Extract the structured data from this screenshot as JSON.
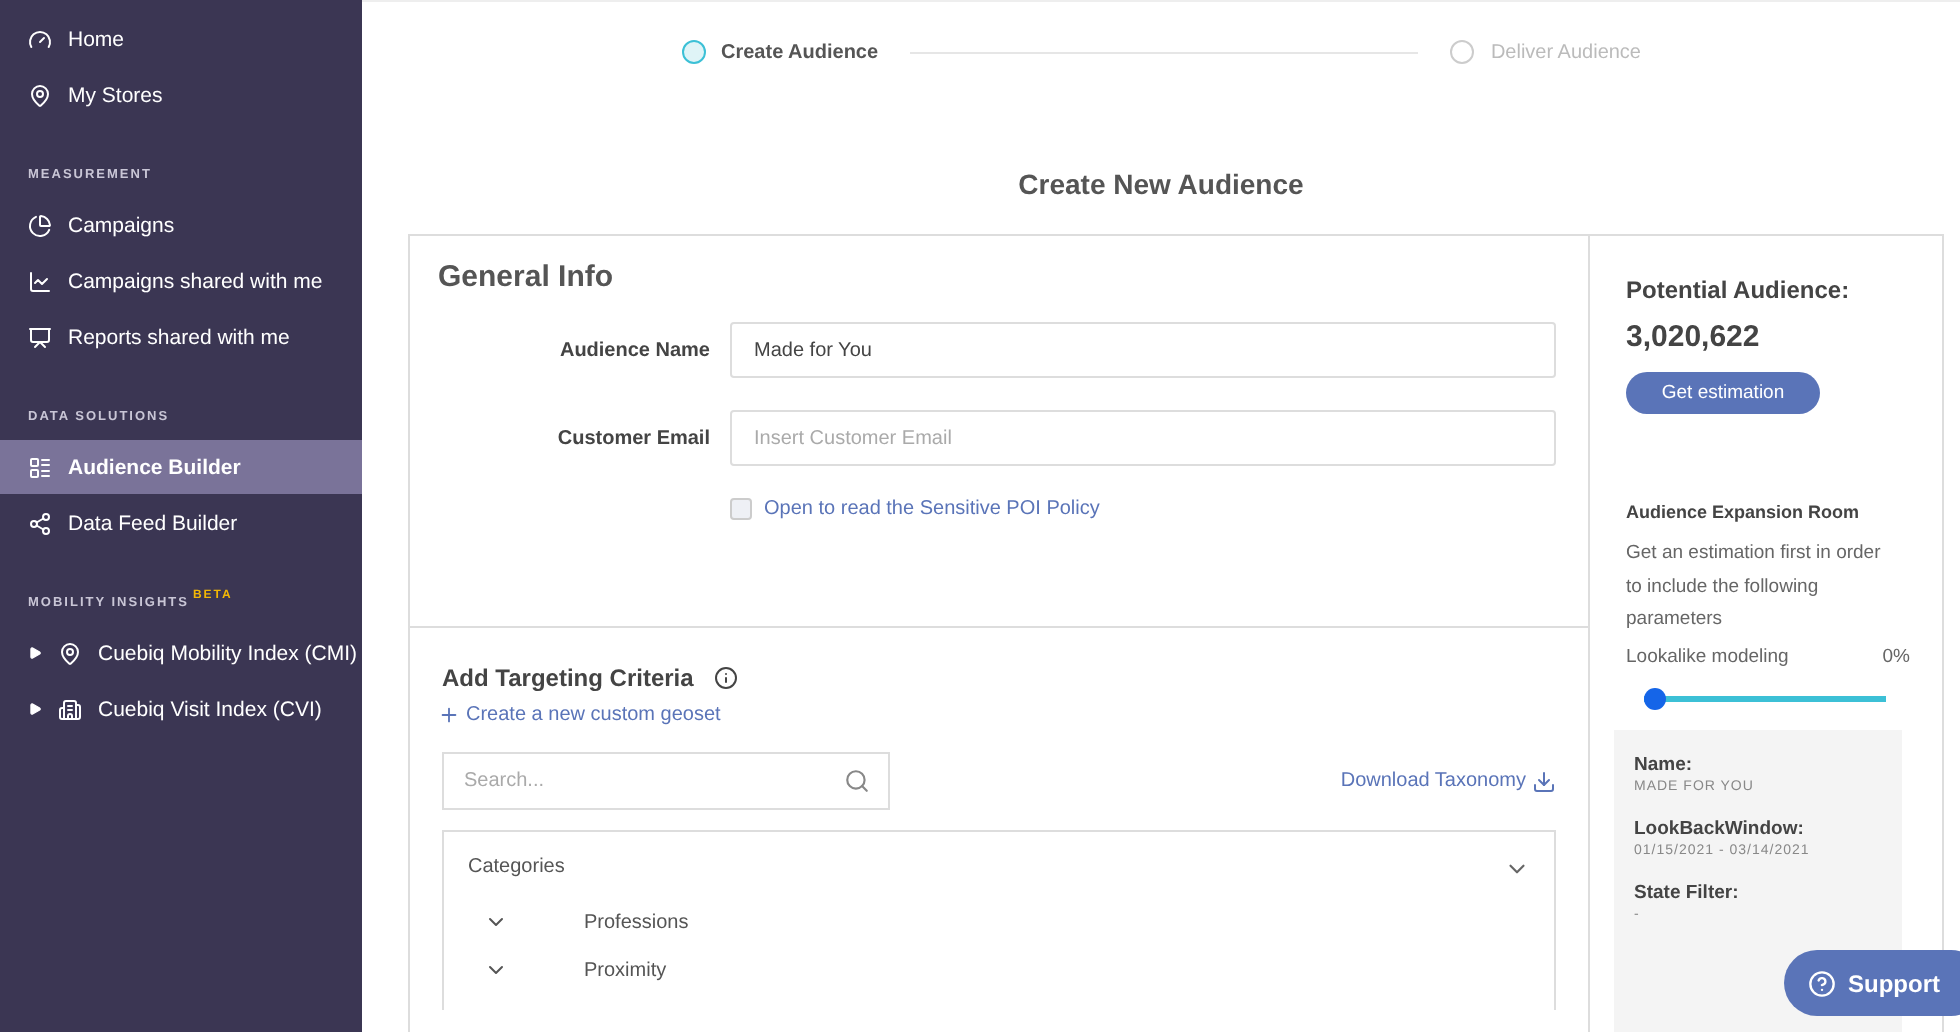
{
  "sidebar": {
    "items": [
      {
        "kind": "item",
        "label": "Home",
        "selected": false
      },
      {
        "kind": "item",
        "label": "My Stores",
        "selected": false
      },
      {
        "kind": "section",
        "label": "MEASUREMENT"
      },
      {
        "kind": "item",
        "label": "Campaigns",
        "selected": false
      },
      {
        "kind": "item",
        "label": "Campaigns shared with me",
        "selected": false
      },
      {
        "kind": "item",
        "label": "Reports shared with me",
        "selected": false
      },
      {
        "kind": "section",
        "label": "DATA SOLUTIONS"
      },
      {
        "kind": "item",
        "label": "Audience Builder",
        "selected": true
      },
      {
        "kind": "item",
        "label": "Data Feed Builder",
        "selected": false
      },
      {
        "kind": "section",
        "label": "MOBILITY INSIGHTS",
        "badge": "BETA"
      },
      {
        "kind": "expandable",
        "label": "Cuebiq Mobility Index (CMI)",
        "selected": false,
        "expanded": false
      },
      {
        "kind": "expandable",
        "label": "Cuebiq Visit Index (CVI)",
        "selected": false,
        "expanded": false
      }
    ]
  },
  "stepper": [
    {
      "label": "Create Audience",
      "selected": true
    },
    {
      "label": "Deliver Audience",
      "selected": false
    }
  ],
  "page_title": "Create New Audience",
  "general_info": {
    "title": "General Info",
    "fields": [
      {
        "label": "Audience Name",
        "value": "Made for You"
      },
      {
        "label": "Customer Email",
        "placeholder": "Insert Customer Email"
      }
    ],
    "policy": {
      "label": "Open to read the Sensitive POI Policy",
      "checked": false
    }
  },
  "targeting": {
    "title": "Add Targeting Criteria",
    "create_link": "Create a new custom geoset",
    "search": {
      "placeholder": "Search..."
    },
    "download": "Download Taxonomy",
    "categories": {
      "title": "Categories",
      "items": [
        {
          "label": "Professions",
          "expanded": false
        },
        {
          "label": "Proximity",
          "expanded": false
        }
      ]
    }
  },
  "potential": {
    "title": "Potential Audience:",
    "count": "3,020,622",
    "button": "Get estimation",
    "expansion_title": "Audience Expansion Room",
    "expansion_text": "Get an estimation first in order to include the following parameters",
    "slider": {
      "label": "Lookalike modeling",
      "reading": "0%",
      "level": 0
    },
    "summary": [
      {
        "label": "Name:",
        "value": "MADE FOR YOU"
      },
      {
        "label": "LookBackWindow:",
        "value": "01/15/2021 - 03/14/2021"
      },
      {
        "label": "State Filter:",
        "value": "-"
      }
    ]
  },
  "support": "Support"
}
